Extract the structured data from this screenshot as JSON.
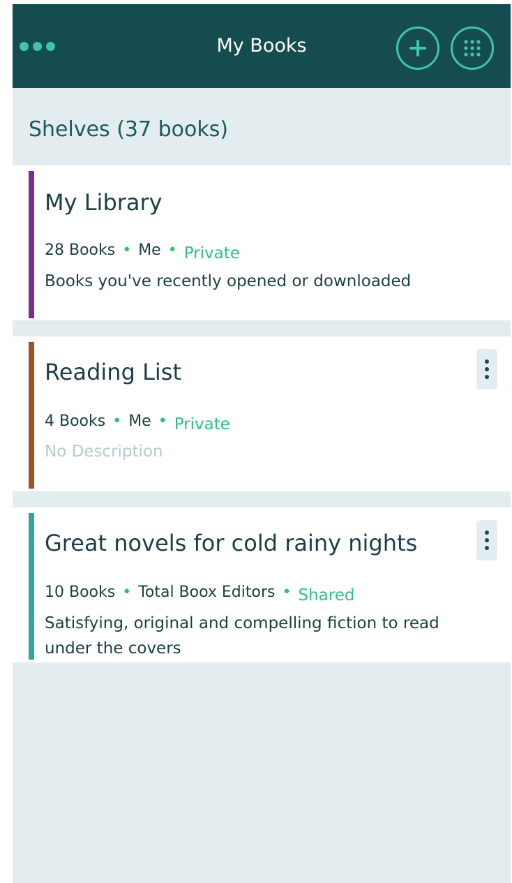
{
  "header": {
    "title": "My Books",
    "menu_icon": "ellipsis-icon",
    "add_icon": "plus-icon",
    "grid_icon": "grid-icon"
  },
  "section": {
    "title": "Shelves (37 books)"
  },
  "shelves": [
    {
      "title": "My Library",
      "count": "28 Books",
      "owner": "Me",
      "privacy": "Private",
      "description": "Books you've recently opened or downloaded",
      "accent_color": "#7b2d8f",
      "has_menu": false
    },
    {
      "title": "Reading List",
      "count": "4 Books",
      "owner": "Me",
      "privacy": "Private",
      "description": "No Description",
      "accent_color": "#a0521c",
      "has_menu": true
    },
    {
      "title": "Great novels for cold rainy nights",
      "count": "10 Books",
      "owner": "Total Boox Editors",
      "privacy": "Shared",
      "description": "Satisfying, original and compelling fiction to read under the covers",
      "accent_color": "#2fa699",
      "has_menu": true
    }
  ],
  "colors": {
    "header_bg": "#154c50",
    "accent_green": "#3fc6a4",
    "background": "#e3ecee"
  }
}
